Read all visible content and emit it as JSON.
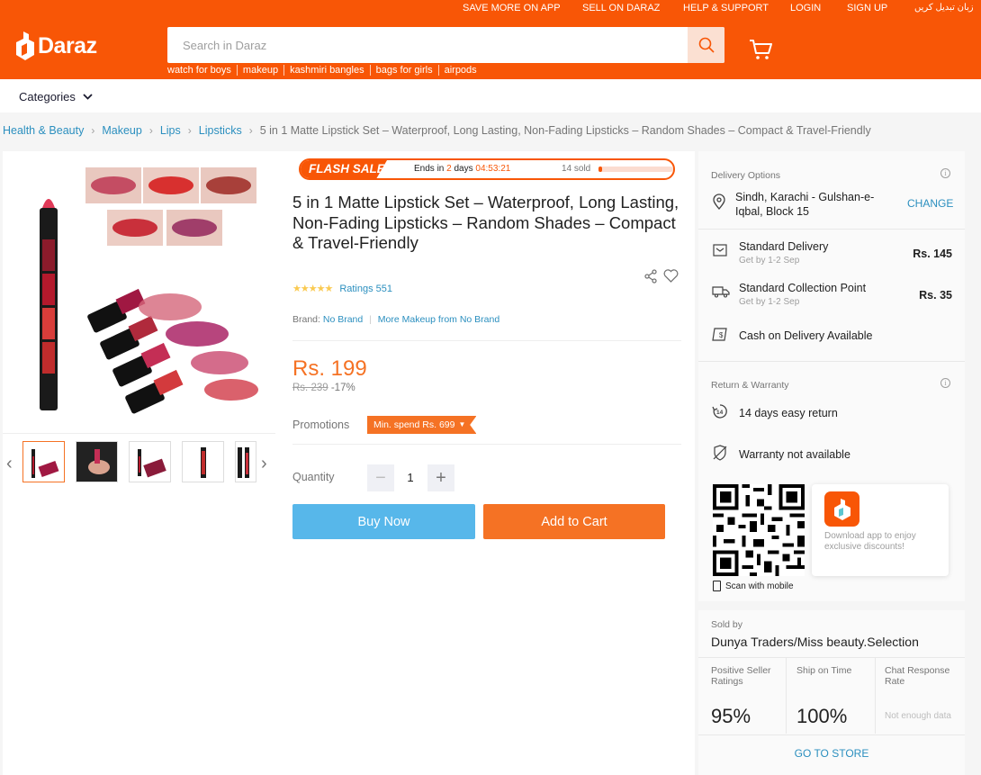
{
  "header": {
    "top_links": [
      "SAVE MORE ON APP",
      "SELL ON DARAZ",
      "HELP & SUPPORT",
      "LOGIN",
      "SIGN UP",
      "زبان تبدیل کریں"
    ],
    "logo_text": "Daraz",
    "search_placeholder": "Search in Daraz",
    "suggestions": [
      "watch for boys",
      "makeup",
      "kashmiri bangles",
      "bags for girls",
      "airpods"
    ],
    "categories_label": "Categories",
    "brand_color": "#f85606"
  },
  "breadcrumb": [
    "Health & Beauty",
    "Makeup",
    "Lips",
    "Lipsticks",
    "5 in 1 Matte Lipstick Set – Waterproof, Long Lasting, Non-Fading Lipsticks – Random Shades – Compact & Travel-Friendly"
  ],
  "product": {
    "flash_sale": {
      "label": "FLASH SALE",
      "ends_prefix": "Ends in",
      "days": "2",
      "days_label": "days",
      "time": "04:53:21",
      "sold": "14 sold",
      "sold_fraction": 0.05
    },
    "title": "5 in 1 Matte Lipstick Set – Waterproof, Long Lasting, Non-Fading Lipsticks – Random Shades – Compact & Travel-Friendly",
    "stars": "★★★★★",
    "ratings": "Ratings 551",
    "brand_label": "Brand:",
    "brand": "No Brand",
    "more_from": "More Makeup from No Brand",
    "price": "Rs. 199",
    "old_price": "Rs. 239",
    "discount": "-17%",
    "promotions_label": "Promotions",
    "promo_tag": "Min. spend Rs. 699",
    "quantity_label": "Quantity",
    "quantity": "1",
    "minus": "−",
    "plus": "+",
    "buy_now": "Buy Now",
    "add_to_cart": "Add to Cart"
  },
  "delivery": {
    "header": "Delivery Options",
    "location": "Sindh, Karachi - Gulshan-e-Iqbal, Block 15",
    "change": "CHANGE",
    "options": [
      {
        "title": "Standard Delivery",
        "sub": "Get by 1-2 Sep",
        "price": "Rs. 145"
      },
      {
        "title": "Standard Collection Point",
        "sub": "Get by 1-2 Sep",
        "price": "Rs. 35"
      }
    ],
    "cod": "Cash on Delivery Available",
    "return_header": "Return & Warranty",
    "return_text": "14 days easy return",
    "return_icon_number": "14",
    "warranty_text": "Warranty not available",
    "scan": "Scan with mobile",
    "app_text": "Download app to enjoy exclusive discounts!"
  },
  "seller": {
    "label": "Sold by",
    "name": "Dunya Traders/Miss beauty.Selection",
    "metrics": [
      {
        "label": "Positive Seller Ratings",
        "value": "95%"
      },
      {
        "label": "Ship on Time",
        "value": "100%"
      },
      {
        "label": "Chat Response Rate",
        "value": "Not enough data"
      }
    ],
    "go_to_store": "GO TO STORE"
  }
}
